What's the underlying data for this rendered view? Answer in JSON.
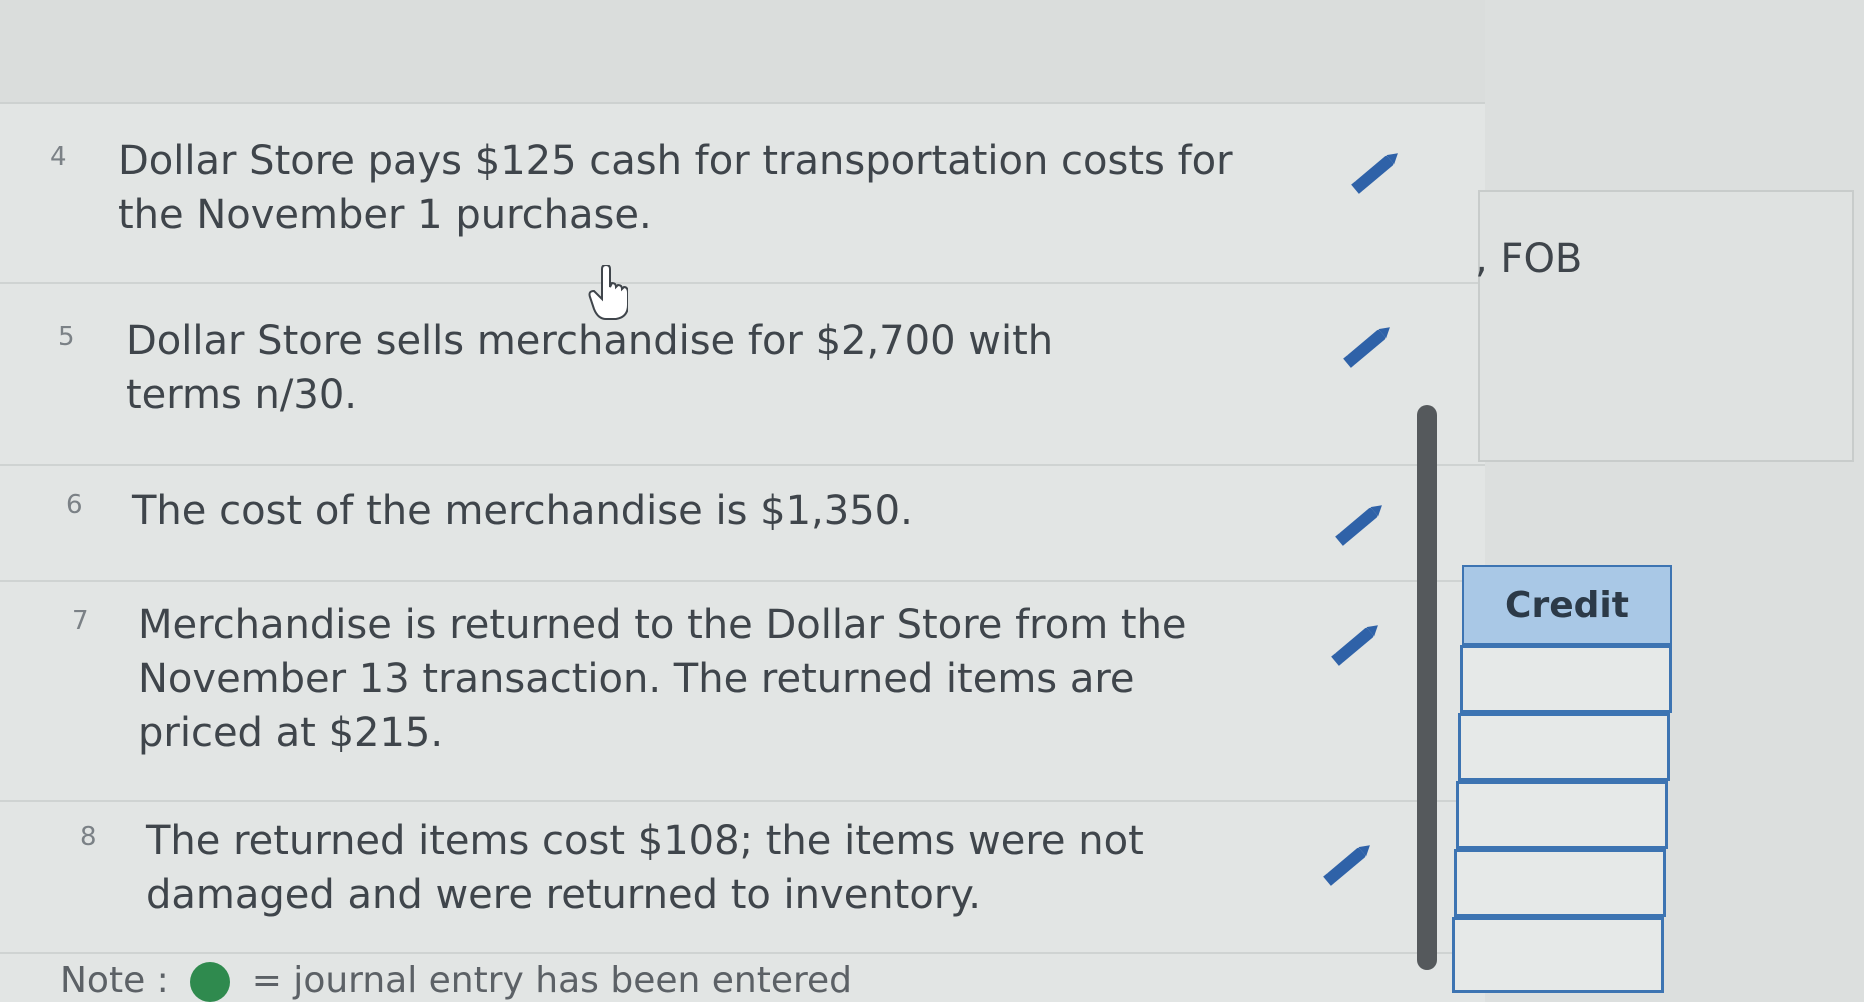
{
  "rows": [
    {
      "num": "4",
      "text": "Dollar Store pays $125 cash for transportation costs for the November 1 purchase."
    },
    {
      "num": "5",
      "text": "Dollar Store sells merchandise for $2,700 with terms n/30."
    },
    {
      "num": "6",
      "text": "The cost of the merchandise is $1,350."
    },
    {
      "num": "7",
      "text": "Merchandise is returned to the Dollar Store from the November 13 transaction. The returned items are priced at $215."
    },
    {
      "num": "8",
      "text": "The returned items cost $108; the items were not damaged and were returned to inventory."
    }
  ],
  "right": {
    "fob_text": ", FOB",
    "credit_header": "Credit",
    "credit_values": [
      "",
      "",
      "",
      "",
      ""
    ]
  },
  "note": {
    "prefix": "Note :",
    "suffix": "= journal entry has been entered"
  },
  "icons": {
    "edit": "pencil-icon",
    "status": "green-circle-icon",
    "cursor": "hand-cursor-icon"
  },
  "colors": {
    "pencil": "#2f62a8",
    "credit_header_bg": "#a9c8e6",
    "credit_border": "#3d74b2",
    "entered_dot": "#2f8a4e"
  }
}
